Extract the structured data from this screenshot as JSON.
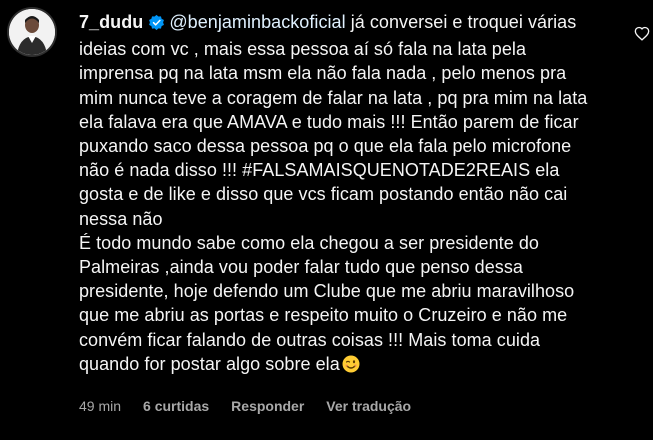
{
  "comment": {
    "username": "7_dudu",
    "mention": "@benjaminbackoficial",
    "text": " já conversei e troquei várias ideias com vc , mais essa pessoa aí só fala na lata pela imprensa pq na lata msm ela não fala nada , pelo menos pra mim nunca teve a coragem de falar na lata , pq pra mim na lata ela falava era que AMAVA e tudo mais !!! Então parem de ficar puxando saco dessa pessoa pq o que ela fala pelo microfone não é nada disso !!! #FALSAMAISQUENOTADE2REAIS ela gosta e de like e disso que vcs ficam postando então não cai nessa não\nÉ todo mundo sabe como ela chegou a ser presidente do Palmeiras ,ainda vou poder falar tudo que penso dessa presidente, hoje defendo um Clube que me abriu maravilhoso que me abriu as portas e respeito muito o Cruzeiro e não me convém ficar falando de outras coisas !!! Mais toma cuida quando for postar algo sobre ela",
    "emoji_icon": "winking-face-emoji",
    "verified_icon": "verified-badge-icon",
    "like_icon": "heart-outline-icon"
  },
  "meta": {
    "time": "49 min",
    "likes": "6 curtidas",
    "reply": "Responder",
    "translate": "Ver tradução"
  },
  "colors": {
    "background": "#000000",
    "text": "#f5f5f5",
    "secondary": "#a8a8a8",
    "verified": "#0095f6"
  }
}
